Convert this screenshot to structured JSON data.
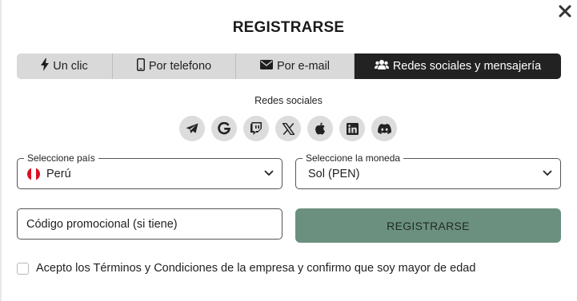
{
  "dialog": {
    "title": "REGISTRARSE",
    "close_icon": "close-icon"
  },
  "tabs": [
    {
      "label": "Un clic",
      "icon": "bolt-icon",
      "active": false
    },
    {
      "label": "Por telefono",
      "icon": "phone-icon",
      "active": false
    },
    {
      "label": "Por e-mail",
      "icon": "envelope-icon",
      "active": false
    },
    {
      "label": "Redes sociales y mensajería",
      "icon": "users-icon",
      "active": true
    }
  ],
  "social": {
    "label": "Redes sociales",
    "icons": [
      "telegram-icon",
      "google-icon",
      "twitch-icon",
      "x-icon",
      "apple-icon",
      "linkedin-icon",
      "discord-icon"
    ]
  },
  "country": {
    "label": "Seleccione país",
    "value": "Perú",
    "flag_colors": [
      "#d91023",
      "#ffffff",
      "#d91023"
    ]
  },
  "currency": {
    "label": "Seleccione la moneda",
    "value": "Sol (PEN)"
  },
  "promo": {
    "placeholder": "Código promocional (si tiene)"
  },
  "register_button": {
    "label": "REGISTRARSE",
    "color": "#6b9080"
  },
  "terms": {
    "text": "Acepto los Términos y Condiciones de la empresa y confirmo que soy mayor de edad",
    "checked": false
  }
}
